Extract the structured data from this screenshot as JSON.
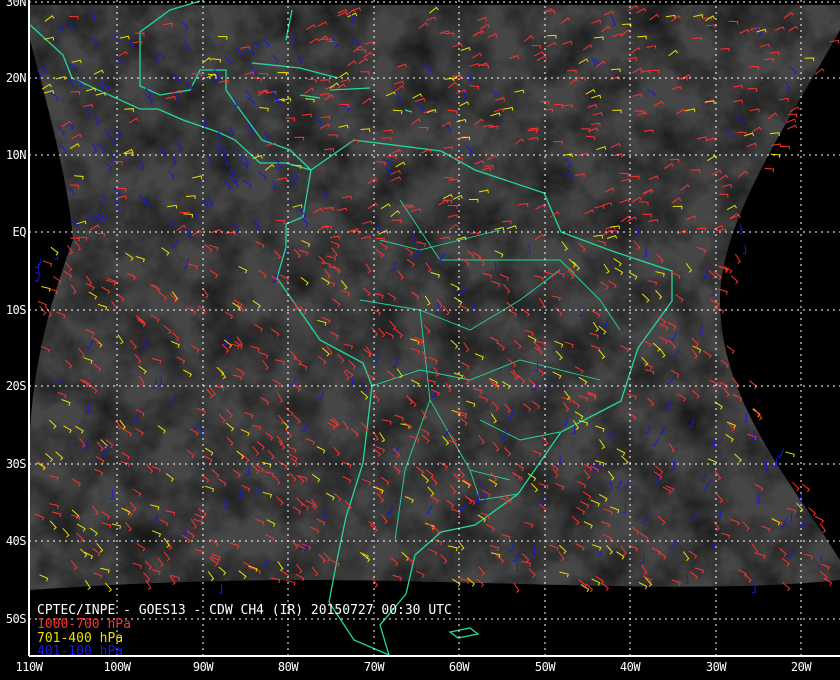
{
  "title": "CPTEC/INPE - GOES13 - CDW CH4 (IR) 20150727 00:30 UTC",
  "legend": [
    {
      "label": "1000-700 hPa",
      "color": "#ff3030"
    },
    {
      "label": "701-400 hPa",
      "color": "#e8e000"
    },
    {
      "label": "401-100 hPa",
      "color": "#1818e0"
    }
  ],
  "lat_labels": [
    "30N",
    "20N",
    "10N",
    "EQ",
    "10S",
    "20S",
    "30S",
    "40S",
    "50S"
  ],
  "lon_labels": [
    "110W",
    "100W",
    "90W",
    "80W",
    "70W",
    "60W",
    "50W",
    "40W",
    "30W",
    "20W"
  ],
  "colors": {
    "coastline": "#22d89a",
    "grid": "#ffffff",
    "background": "#000000",
    "cloud_base": "#4a4a4a"
  }
}
